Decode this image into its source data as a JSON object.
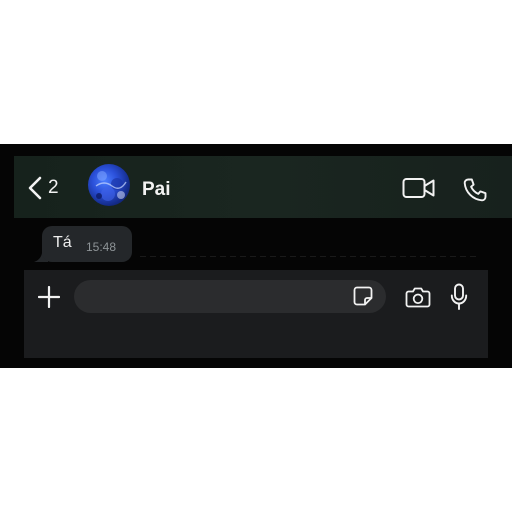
{
  "header": {
    "back_count": "2",
    "contact_name": "Pai",
    "icons": [
      "chevron-left-icon",
      "video-call-icon",
      "phone-icon"
    ]
  },
  "messages": [
    {
      "text": "Tá",
      "time": "15:48",
      "direction": "incoming"
    }
  ],
  "composer": {
    "placeholder": "",
    "icons": [
      "plus-icon",
      "sticker-icon",
      "camera-icon",
      "microphone-icon"
    ]
  },
  "colors": {
    "page_background": "#ffffff",
    "screen_background": "#050505",
    "header_background": "#1a2620",
    "bubble_background": "#24272a",
    "input_bar_background": "#1b1c1e",
    "text_field_background": "#2b2c2e",
    "timestamp_color": "#8e9497"
  }
}
